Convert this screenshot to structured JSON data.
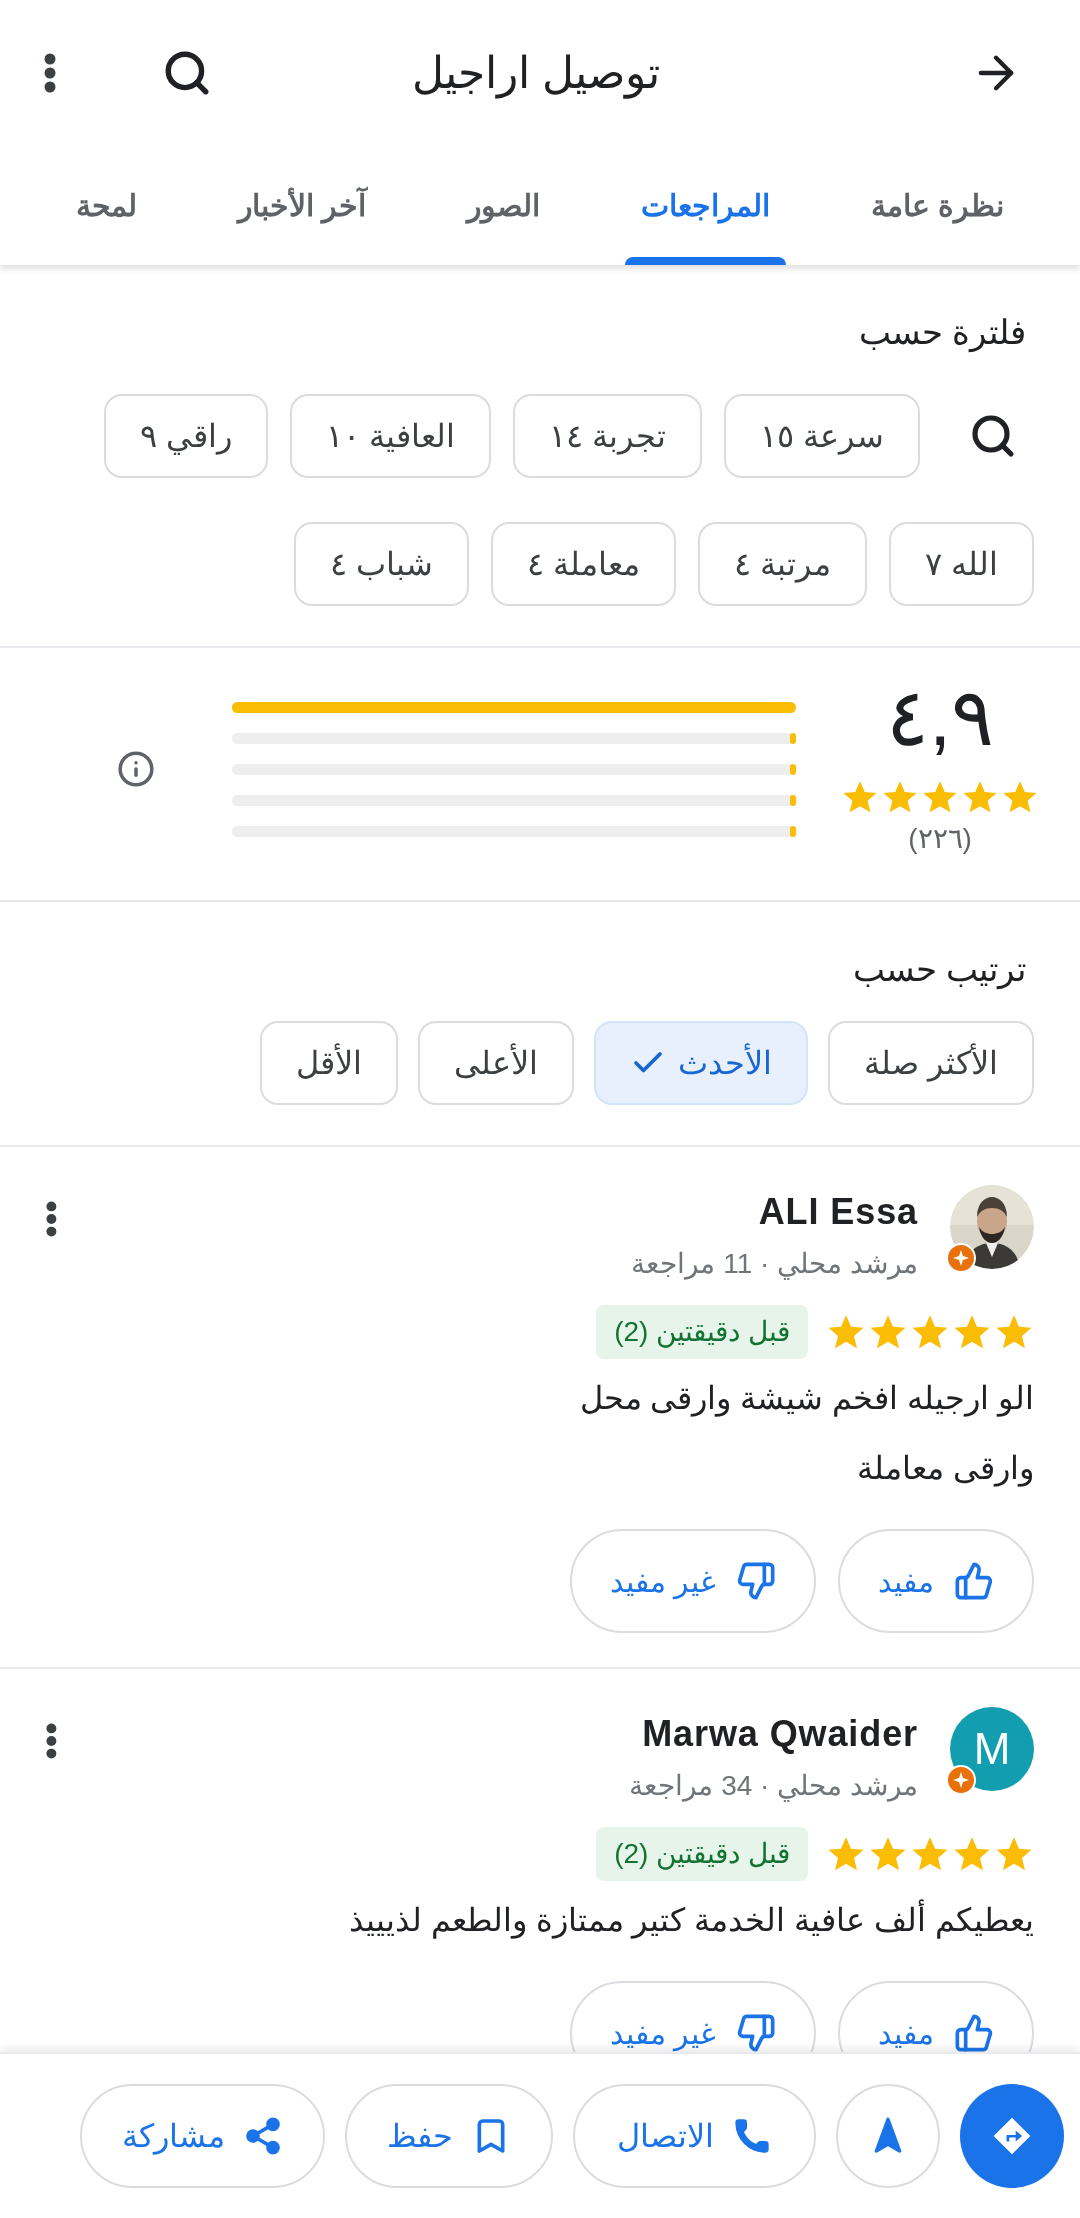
{
  "header": {
    "title": "توصيل اراجيل"
  },
  "tabs": [
    {
      "label": "نظرة عامة",
      "selected": false
    },
    {
      "label": "المراجعات",
      "selected": true
    },
    {
      "label": "الصور",
      "selected": false
    },
    {
      "label": "آخر الأخبار",
      "selected": false
    },
    {
      "label": "لمحة",
      "selected": false
    }
  ],
  "filter": {
    "label": "فلترة حسب",
    "chip_rows": [
      [
        "سرعة ١٥",
        "تجربة ١٤",
        "العافية ١٠",
        "راقي ٩"
      ],
      [
        "الله ٧",
        "مرتبة ٤",
        "معاملة ٤",
        "شباب ٤"
      ]
    ]
  },
  "rating": {
    "score": "٤,٩",
    "stars": 5,
    "count": "(٢٢٦)",
    "bars": [
      {
        "level": 1
      },
      {
        "level": 0.01
      },
      {
        "level": 0.01
      },
      {
        "level": 0.01
      },
      {
        "level": 0.01
      }
    ]
  },
  "sort": {
    "label": "ترتيب حسب",
    "options": [
      {
        "label": "الأكثر صلة",
        "selected": false
      },
      {
        "label": "الأحدث",
        "selected": true
      },
      {
        "label": "الأعلى",
        "selected": false
      },
      {
        "label": "الأقل",
        "selected": false
      }
    ]
  },
  "reviews": [
    {
      "name": "ALI Essa",
      "meta": "مرشد محلي · 11 مراجعة",
      "stars": 5,
      "time": "قبل دقيقتين (2)",
      "text": "الو ارجيله افخم شيشة وارقى محل\nوارقى معاملة",
      "buttons": [
        "مفيد",
        "غير مفيد"
      ]
    },
    {
      "name": "Marwa Qwaider",
      "meta": "مرشد محلي · 34 مراجعة",
      "avatar": {
        "kind": "letter",
        "letter": "M",
        "color": "#129eaf"
      },
      "stars": 5,
      "time": "قبل دقيقتين (2)",
      "text": "يعطيكم ألف عافية الخدمة كتير ممتازة والطعم لذيييذ",
      "buttons": [
        "مفيد",
        "غير مفيد"
      ]
    }
  ],
  "bottom_bar": {
    "buttons": [
      {
        "kind": "directions"
      },
      {
        "kind": "navigate"
      },
      {
        "kind": "call",
        "label": "الاتصال"
      },
      {
        "kind": "save",
        "label": "حفظ"
      },
      {
        "kind": "share",
        "label": "مشاركة"
      }
    ]
  }
}
